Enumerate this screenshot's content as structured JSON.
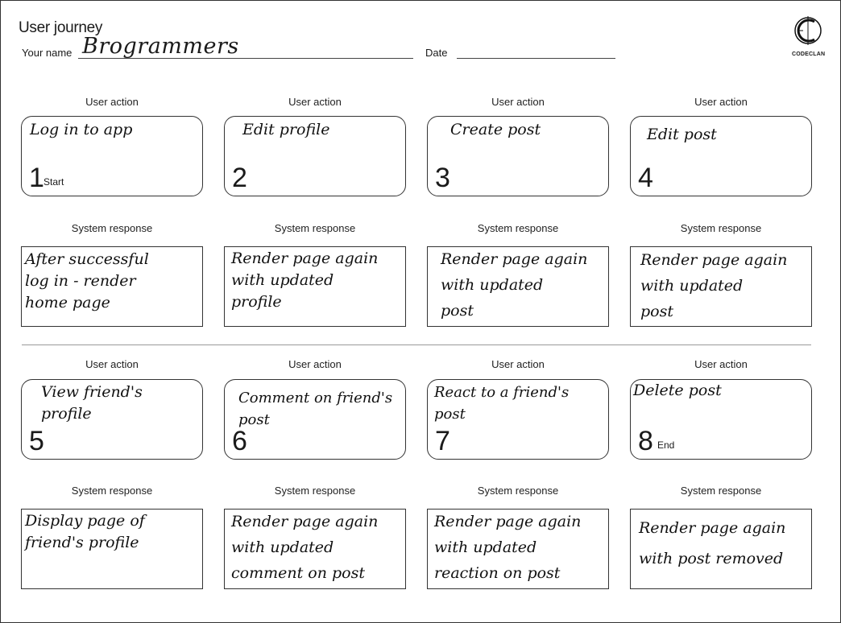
{
  "header": {
    "title": "User journey",
    "name_label": "Your name",
    "name_value": "Brogrammers",
    "date_label": "Date",
    "date_value": "",
    "logo_text": "CODECLAN",
    "logo_icon": "codeclan-c-logo"
  },
  "labels": {
    "user_action": "User action",
    "system_response": "System response"
  },
  "steps": [
    {
      "number": "1",
      "tag": "Start",
      "action": "Log in to app",
      "response": "After successful\nlog in - render\nhome page"
    },
    {
      "number": "2",
      "tag": "",
      "action": "Edit profile",
      "response": "Render page again\nwith updated\nprofile"
    },
    {
      "number": "3",
      "tag": "",
      "action": "Create post",
      "response": "Render page again\nwith updated\npost"
    },
    {
      "number": "4",
      "tag": "",
      "action": "Edit post",
      "response": "Render page again\nwith updated\npost"
    },
    {
      "number": "5",
      "tag": "",
      "action": "View friend's\nprofile",
      "response": "Display page of\nfriend's profile"
    },
    {
      "number": "6",
      "tag": "",
      "action": "Comment on friend's\npost",
      "response": "Render page again\nwith updated\ncomment on post"
    },
    {
      "number": "7",
      "tag": "",
      "action": "React to a friend's\npost",
      "response": "Render page again\nwith updated\nreaction on post"
    },
    {
      "number": "8",
      "tag": "End",
      "action": "Delete post",
      "response": "Render page again\nwith post removed"
    }
  ]
}
